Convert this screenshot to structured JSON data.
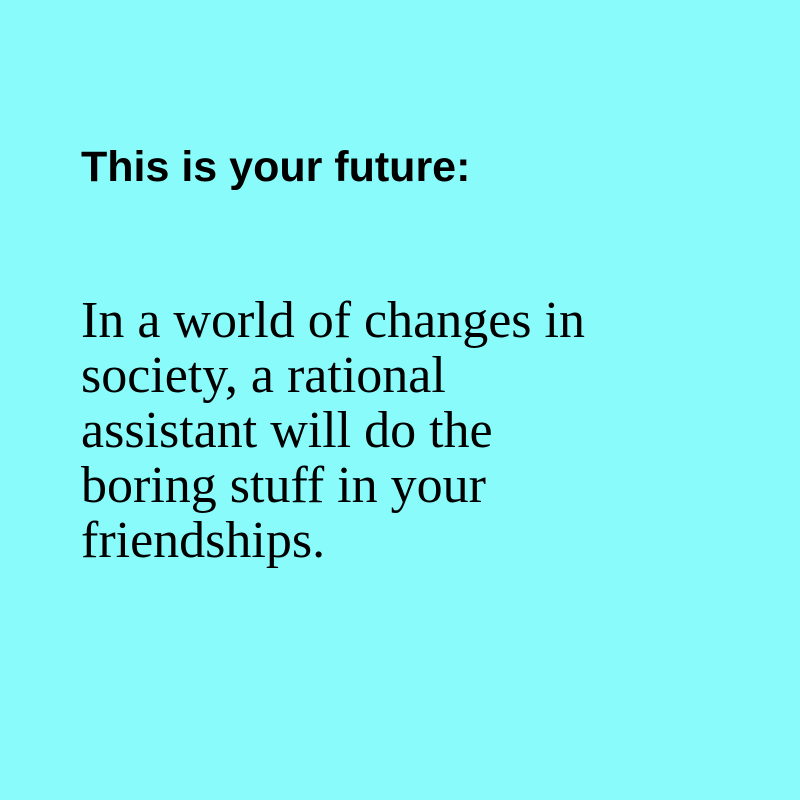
{
  "heading": "This is your future:",
  "body_lines": [
    "In a world of changes in",
    "society, a rational",
    "assistant will do the",
    "boring stuff in your",
    "friendships."
  ],
  "colors": {
    "background": "#88fbfa",
    "text": "#000000"
  }
}
